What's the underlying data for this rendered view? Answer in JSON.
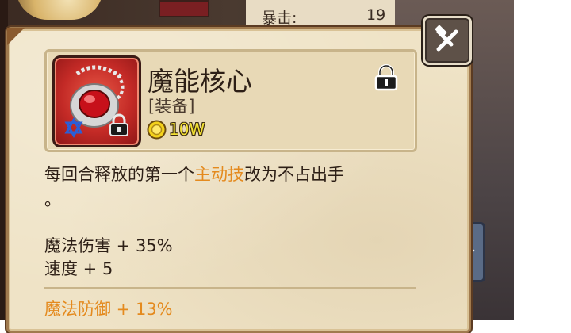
{
  "background": {
    "stats": [
      {
        "label": "暴击:",
        "value": "19"
      }
    ]
  },
  "item": {
    "name": "魔能核心",
    "type": "[装备]",
    "price": "10W",
    "description_before": "每回合释放的第一个",
    "description_highlight": "主动技",
    "description_after": "改为不占出手",
    "description_tail": "。"
  },
  "stats": {
    "base": [
      "魔法伤害 + 35%",
      "速度 + 5"
    ],
    "bonus": [
      "魔法防御 + 13%"
    ]
  },
  "colors": {
    "highlight": "#e48a1e",
    "price": "#f2e034",
    "text": "#2d1f16"
  },
  "icons": {
    "close": "hammer-close-icon",
    "lock": "lock-icon",
    "coin": "coin-icon",
    "item": "red-gem-pendant-icon"
  }
}
